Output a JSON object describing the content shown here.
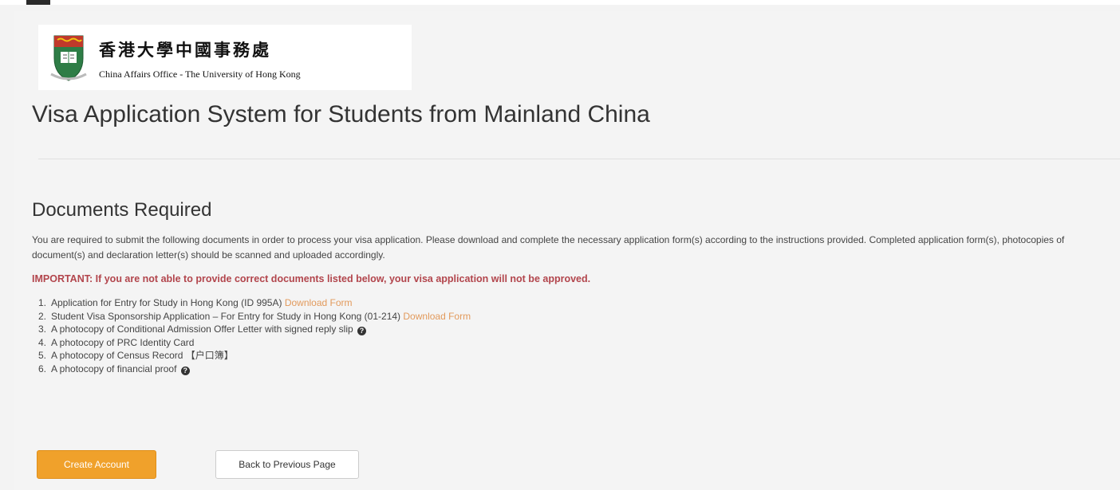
{
  "header": {
    "logo_chinese": "香港大學中國事務處",
    "logo_english": "China Affairs Office - The University of Hong Kong"
  },
  "page_title": "Visa Application System for Students from Mainland China",
  "documents": {
    "heading": "Documents Required",
    "intro": "You are required to submit the following documents in order to process your visa application. Please download and complete the necessary application form(s) according to the instructions provided. Completed application form(s), photocopies of document(s) and declaration letter(s) should be scanned and uploaded accordingly.",
    "important": "IMPORTANT: If you are not able to provide correct documents listed below, your visa application will not be approved.",
    "download_label": "Download Form",
    "items": [
      {
        "num": "1.",
        "text": "Application for Entry for Study in Hong Kong (ID 995A)"
      },
      {
        "num": "2.",
        "text": "Student Visa Sponsorship Application – For Entry for Study in Hong Kong (01-214)"
      },
      {
        "num": "3.",
        "text": "A photocopy of Conditional Admission Offer Letter with signed reply slip"
      },
      {
        "num": "4.",
        "text": "A photocopy of PRC Identity Card"
      },
      {
        "num": "5.",
        "text": "A photocopy of Census Record 【户口簿】"
      },
      {
        "num": "6.",
        "text": "A photocopy of financial proof"
      }
    ]
  },
  "buttons": {
    "create_account": "Create Account",
    "back": "Back to Previous Page"
  },
  "colors": {
    "accent_orange": "#f0a12b",
    "important_red": "#b2454c",
    "link_orange": "#e29a5c"
  },
  "icons": {
    "help": "question-circle-icon",
    "crest": "university-crest-icon"
  }
}
